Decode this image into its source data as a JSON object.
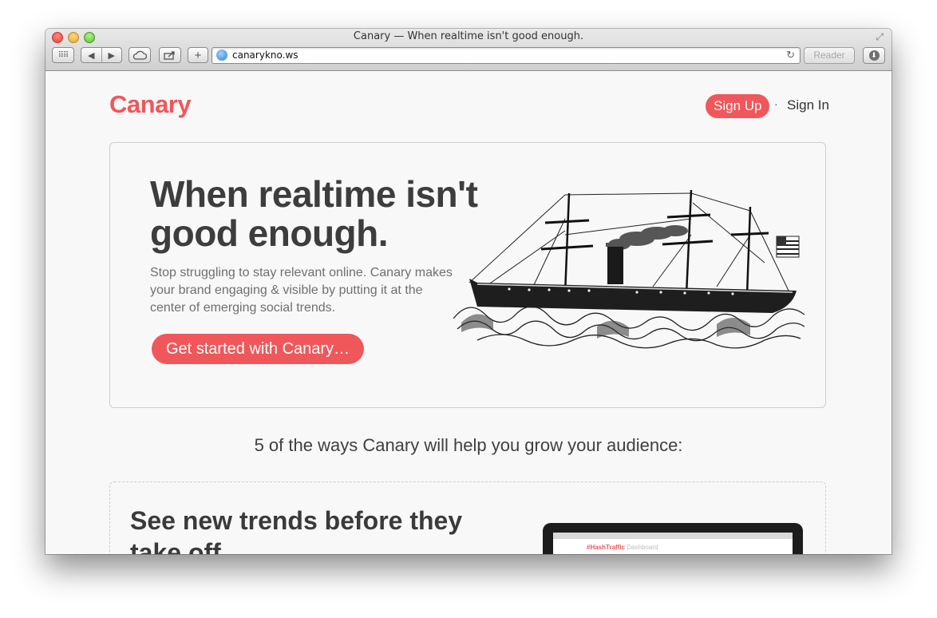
{
  "window": {
    "title": "Canary — When realtime isn't good enough.",
    "url": "canarykno.ws",
    "reader_label": "Reader"
  },
  "icons": {
    "top_sites": "grid-icon",
    "back": "back-arrow-icon",
    "forward": "forward-arrow-icon",
    "icloud": "cloud-icon",
    "share": "share-icon",
    "new_tab": "plus-icon",
    "site": "globe-icon",
    "reload": "reload-icon",
    "downloads": "download-icon",
    "fullscreen": "fullscreen-icon"
  },
  "header": {
    "logo": "Canary",
    "signup": "Sign Up",
    "separator": "·",
    "signin": "Sign In"
  },
  "hero": {
    "title": "When realtime isn't good enough.",
    "body": "Stop struggling to stay relevant online. Canary makes your brand engaging & visible by putting it at the center of emerging social trends.",
    "cta": "Get started with Canary…"
  },
  "ways_heading": "5 of the ways Canary will help you grow your audience:",
  "feature": {
    "title": "See new trends before they take off",
    "screen_brand": "#HashTraffic",
    "screen_sub": "Dashboard"
  },
  "colors": {
    "accent": "#f0575a",
    "text_dark": "#3d3d3d",
    "page_bg": "#f9f8f8"
  }
}
